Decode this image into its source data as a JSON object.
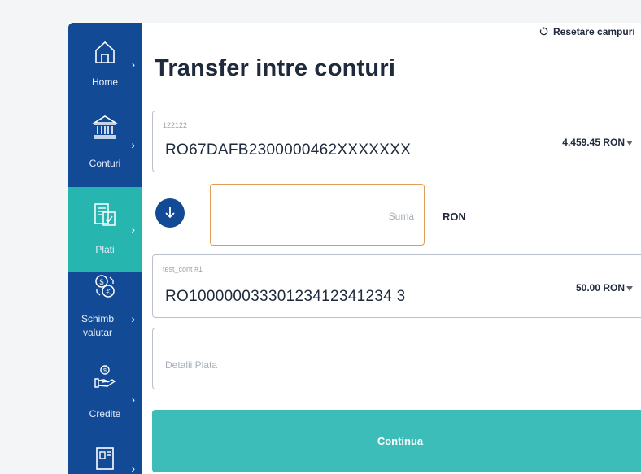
{
  "header": {
    "reset_label": "Resetare campuri",
    "title": "Transfer intre conturi"
  },
  "sidebar": {
    "items": [
      {
        "label": "Home",
        "icon": "home-icon"
      },
      {
        "label": "Conturi",
        "icon": "bank-icon"
      },
      {
        "label": "Plati",
        "icon": "payments-icon",
        "active": true
      },
      {
        "label": "Schimb valutar",
        "icon": "currency-exchange-icon"
      },
      {
        "label": "Credite",
        "icon": "credit-hand-icon"
      }
    ]
  },
  "from_account": {
    "name": "122122",
    "iban": "RO67DAFB2300000462XXXXXXX",
    "balance": "4,459.45 RON"
  },
  "amount": {
    "placeholder": "Suma",
    "currency": "RON"
  },
  "to_account": {
    "name": "test_cont #1",
    "iban": "RO10000003330123412341234 3",
    "balance": "50.00 RON"
  },
  "details": {
    "placeholder": "Detalii Plata"
  },
  "continue_label": "Continua",
  "colors": {
    "sidebar": "#124a96",
    "active": "#27b5b0",
    "button": "#3cbdb9",
    "amount_border": "#e39b55"
  }
}
